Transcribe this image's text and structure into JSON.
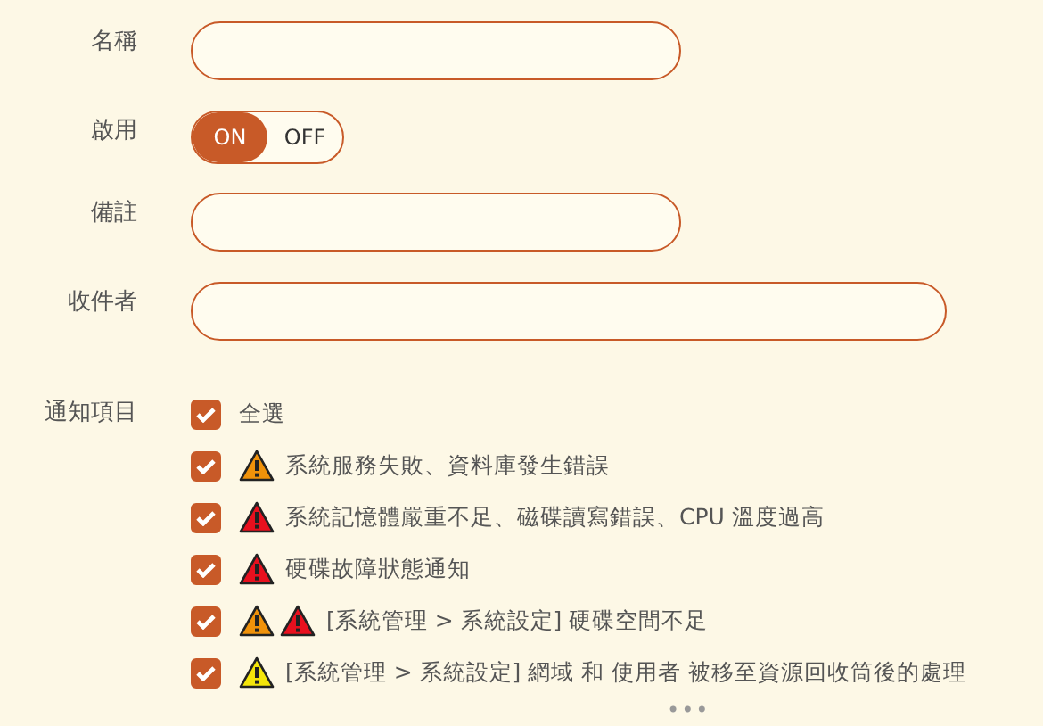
{
  "fields": [
    {
      "kind": "text",
      "label": "名稱"
    },
    {
      "kind": "toggle",
      "label": "啟用",
      "on": true,
      "on_label": "ON",
      "off_label": "OFF"
    },
    {
      "kind": "text",
      "label": "備註"
    },
    {
      "kind": "wide-text",
      "label": "收件者"
    }
  ],
  "notifications": {
    "label": "通知項目",
    "items": [
      {
        "text": "全選",
        "checked": true
      },
      {
        "text": "系統服務失敗、資料庫發生錯誤",
        "checked": true,
        "warnings": [
          {
            "color": "#f0920a"
          }
        ]
      },
      {
        "text": "系統記憶體嚴重不足、磁碟讀寫錯誤、CPU 溫度過高",
        "checked": true,
        "warnings": [
          {
            "color": "#e8101e"
          }
        ]
      },
      {
        "text": "硬碟故障狀態通知",
        "checked": true,
        "warnings": [
          {
            "color": "#e8101e"
          }
        ]
      },
      {
        "text": "[系統管理 > 系統設定] 硬碟空間不足",
        "checked": true,
        "warnings": [
          {
            "color": "#f0920a"
          },
          {
            "color": "#e8101e"
          }
        ]
      },
      {
        "text": "[系統管理 > 系統設定] 網域 和 使用者 被移至資源回收筒後的處理",
        "checked": true,
        "warnings": [
          {
            "color": "#f5e60a"
          }
        ]
      }
    ],
    "more": "•••"
  }
}
